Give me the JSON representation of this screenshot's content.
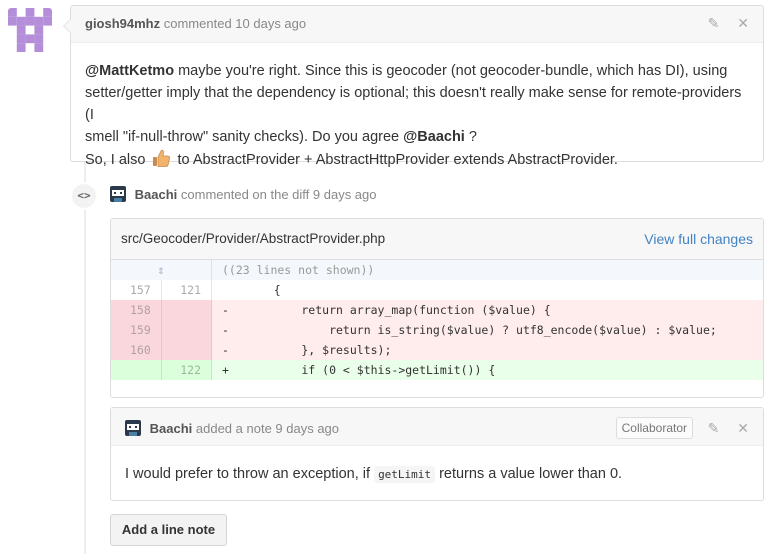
{
  "comment": {
    "author": "giosh94mhz",
    "action_time": "commented 10 days ago",
    "mention1": "@MattKetmo",
    "line1": " maybe you're right. Since this is geocoder (not geocoder-bundle, which has DI), using",
    "line2": "setter/getter imply that the dependency is optional; this doesn't really make sense for remote-providers (I",
    "line3": "smell \"if-null-throw\" sanity checks). Do you agree ",
    "mention2": "@Baachi",
    "line3_end": " ?",
    "line4_start": "So, I also ",
    "line4_end": " to AbstractProvider + AbstractHttpProvider extends AbstractProvider.",
    "edit_icon": "pencil-icon",
    "close_icon": "close-icon"
  },
  "diff_comment": {
    "badge": "<>",
    "author": "Baachi",
    "action_time": "commented on the diff 9 days ago"
  },
  "file": {
    "path": "src/Geocoder/Provider/AbstractProvider.php",
    "view_link": "View full changes",
    "hunk": "((23 lines not shown))",
    "rows": [
      {
        "type": "ctx",
        "old": "157",
        "new": "121",
        "sign": " ",
        "code": "    {"
      },
      {
        "type": "del",
        "old": "158",
        "new": "",
        "sign": "-",
        "code": "        return array_map(function ($value) {"
      },
      {
        "type": "del",
        "old": "159",
        "new": "",
        "sign": "-",
        "code": "            return is_string($value) ? utf8_encode($value) : $value;"
      },
      {
        "type": "del",
        "old": "160",
        "new": "",
        "sign": "-",
        "code": "        }, $results);"
      },
      {
        "type": "add",
        "old": "",
        "new": "122",
        "sign": "+",
        "code": "        if (0 < $this->getLimit()) {"
      }
    ]
  },
  "note": {
    "author": "Baachi",
    "action_time": "added a note 9 days ago",
    "role_badge": "Collaborator",
    "text_start": "I would prefer to throw an exception, if ",
    "code": "getLimit",
    "text_end": " returns a value lower than 0."
  },
  "buttons": {
    "add_line_note": "Add a line note"
  }
}
